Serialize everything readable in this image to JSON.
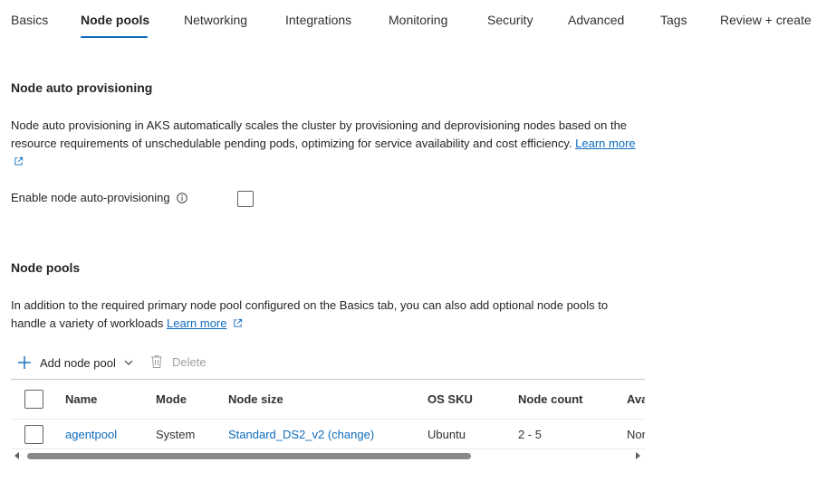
{
  "tabs": [
    "Basics",
    "Node pools",
    "Networking",
    "Integrations",
    "Monitoring",
    "Security",
    "Advanced",
    "Tags",
    "Review + create"
  ],
  "active_tab": "Node pools",
  "auto_provisioning": {
    "heading": "Node auto provisioning",
    "description": "Node auto provisioning in AKS automatically scales the cluster by provisioning and deprovisioning nodes based on the resource requirements of unschedulable pending pods, optimizing for service availability and cost efficiency.",
    "learn_more": "Learn more",
    "enable_label": "Enable node auto-provisioning",
    "enabled": false
  },
  "node_pools": {
    "heading": "Node pools",
    "description": "In addition to the required primary node pool configured on the Basics tab, you can also add optional node pools to handle a variety of workloads",
    "learn_more": "Learn more",
    "toolbar": {
      "add_label": "Add node pool",
      "delete_label": "Delete"
    },
    "columns": [
      "Name",
      "Mode",
      "Node size",
      "OS SKU",
      "Node count",
      "Ava"
    ],
    "rows": [
      {
        "name": "agentpool",
        "mode": "System",
        "node_size": "Standard_DS2_v2 (change)",
        "os_sku": "Ubuntu",
        "node_count": "2 - 5",
        "availability": "Nor"
      }
    ]
  },
  "colors": {
    "accent": "#0f6cbd",
    "text": "#242424",
    "disabled": "#a19f9d"
  }
}
